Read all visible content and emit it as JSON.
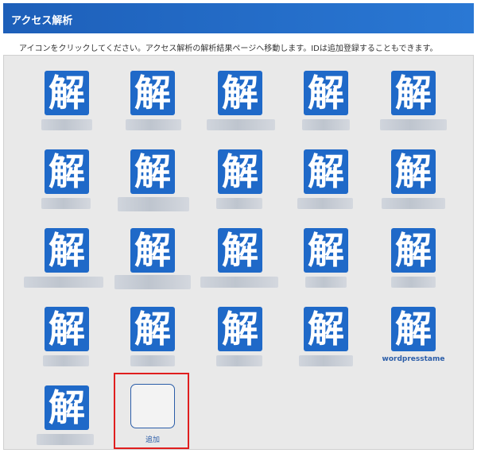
{
  "header": {
    "title": "アクセス解析"
  },
  "instructions": "アイコンをクリックしてください。アクセス解析の解析結果ページへ移動します。IDは追加登録することもできます。",
  "icon": {
    "glyph": "解",
    "color": "#1f69c8"
  },
  "visible_labels": {
    "item_20": "wordpresstame"
  },
  "add": {
    "label": "追加",
    "highlight_color": "#e01e1e"
  }
}
